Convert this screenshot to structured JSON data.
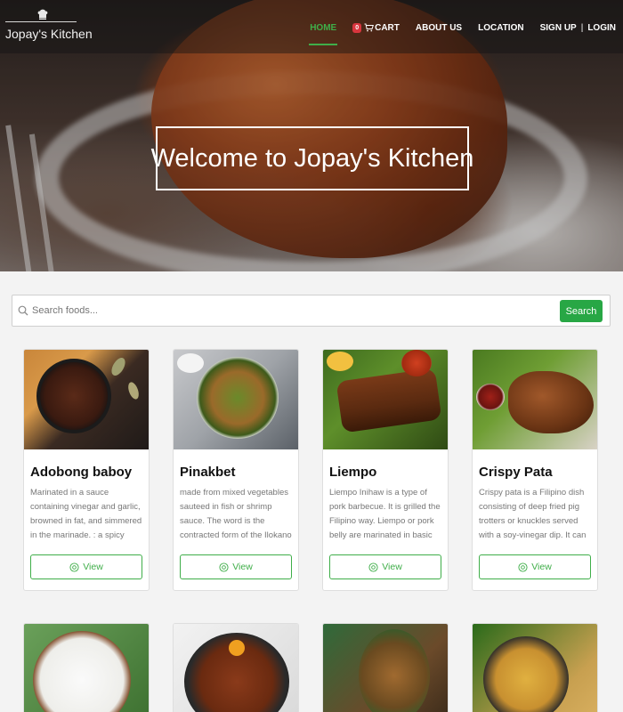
{
  "brand": {
    "name": "Jopay's Kitchen"
  },
  "nav": {
    "home": "HOME",
    "cart_count": "0",
    "cart": "CART",
    "about": "ABOUT US",
    "location": "LOCATION",
    "signup": "SIGN UP",
    "separator": "|",
    "login": "LOGIN"
  },
  "hero": {
    "title": "Welcome to Jopay's Kitchen"
  },
  "search": {
    "placeholder": "Search foods...",
    "button": "Search"
  },
  "foods": [
    {
      "name": "Adobong baboy",
      "description": "Marinated in a sauce containing vinegar and garlic, browned in fat, and simmered in the marinade. : a spicy",
      "button": "View"
    },
    {
      "name": "Pinakbet",
      "description": "made from mixed vegetables sauteed in fish or shrimp sauce. The word is the contracted form of the Ilokano word pinakebbet,",
      "button": "View"
    },
    {
      "name": "Liempo",
      "description": "Liempo Inihaw is a type of pork barbecue. It is grilled the Filipino way. Liempo or pork belly are marinated in basic inihaw",
      "button": "View"
    },
    {
      "name": "Crispy Pata",
      "description": "Crispy pata is a Filipino dish consisting of deep fried pig trotters or knuckles served with a soy-vinegar dip. It can be",
      "button": "View"
    }
  ],
  "colors": {
    "accent": "#3fae49",
    "search_button": "#28a745",
    "cart_badge": "#d9363e"
  },
  "icons": {
    "logo": "chef-hat-icon",
    "cart": "cart-icon",
    "search": "search-icon",
    "view": "eye-icon"
  }
}
